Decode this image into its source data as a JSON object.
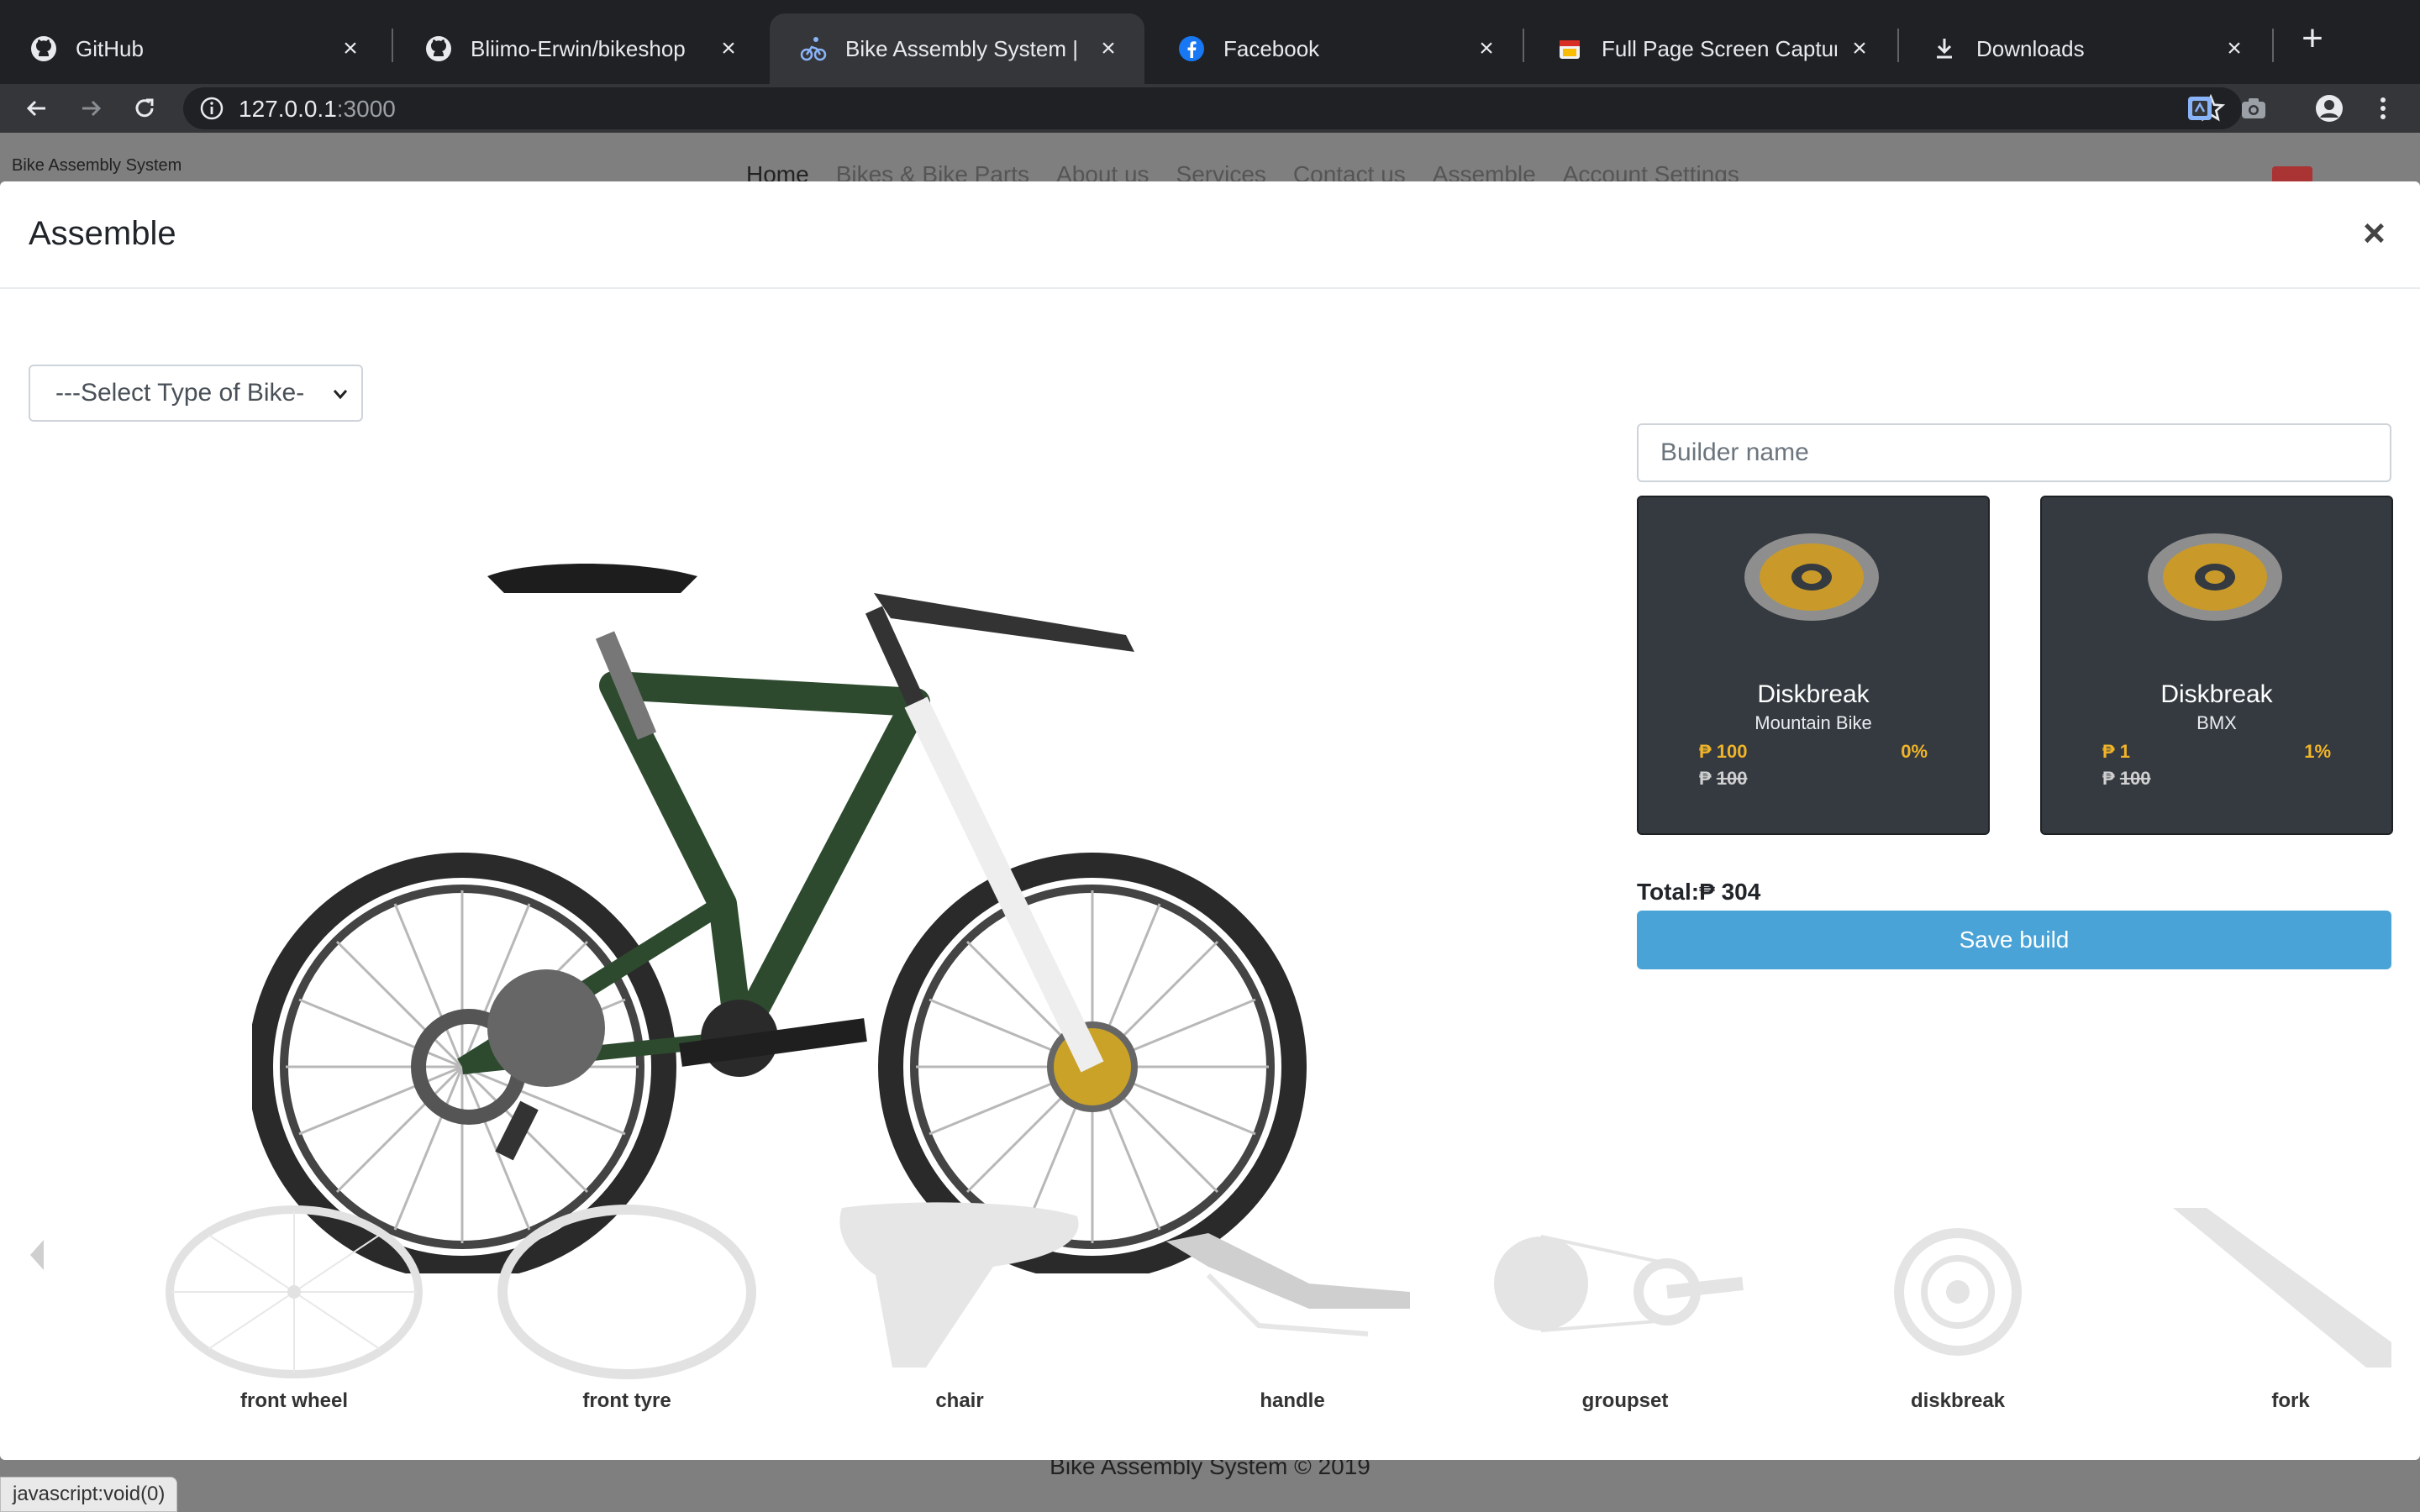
{
  "browser": {
    "tabs": [
      {
        "title": "GitHub",
        "icon": "github-icon",
        "active": false
      },
      {
        "title": "Bliimo-Erwin/bikeshop",
        "icon": "github-icon",
        "active": false
      },
      {
        "title": "Bike Assembly System | Hom",
        "icon": "cyclist-icon",
        "active": true
      },
      {
        "title": "Facebook",
        "icon": "facebook-icon",
        "active": false
      },
      {
        "title": "Full Page Screen Capture - C",
        "icon": "screen-capture-icon",
        "active": false
      },
      {
        "title": "Downloads",
        "icon": "download-icon",
        "active": false
      }
    ],
    "address": {
      "host": "127.0.0.1",
      "port": ":3000"
    }
  },
  "site": {
    "brand": "Bike Assembly System",
    "nav": [
      "Home",
      "Bikes & Bike Parts",
      "About us",
      "Services",
      "Contact us",
      "Assemble",
      "Account Settings"
    ],
    "footer": "Bike Assembly System © 2019"
  },
  "status_text": "javascript:void(0)",
  "modal": {
    "title": "Assemble",
    "close_label": "×",
    "bike_type_select": "---Select Type of Bike-",
    "builder_placeholder": "Builder name",
    "parts": [
      {
        "name": "Diskbreak",
        "category": "Mountain Bike",
        "price": "₱ 100",
        "discount": "0%",
        "original": "100",
        "currency": "₱"
      },
      {
        "name": "Diskbreak",
        "category": "BMX",
        "price": "₱ 1",
        "discount": "1%",
        "original": "100",
        "currency": "₱"
      }
    ],
    "total_label": "Total:",
    "total_value": "₱ 304",
    "save_label": "Save build",
    "part_strip": [
      "front wheel",
      "front tyre",
      "chair",
      "handle",
      "groupset",
      "diskbreak",
      "fork"
    ]
  },
  "colors": {
    "save_button": "#4aa3d6",
    "card_bg": "#343a40",
    "price_accent": "#f0b429",
    "browser_bg": "#202124"
  }
}
